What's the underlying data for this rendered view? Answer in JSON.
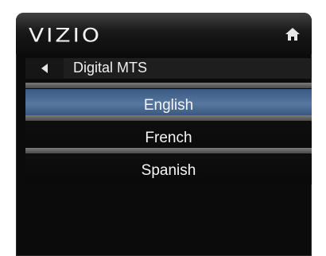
{
  "header": {
    "brand": "VIZIO"
  },
  "nav": {
    "title": "Digital MTS"
  },
  "menu": {
    "items": [
      {
        "label": "English",
        "selected": true
      },
      {
        "label": "French",
        "selected": false
      },
      {
        "label": "Spanish",
        "selected": false
      }
    ]
  },
  "colors": {
    "selected_bg": "#4a6b95",
    "frame_bg": "#0b0b0b",
    "separator": "#6a6a6a"
  },
  "icons": {
    "home": "home-icon",
    "back": "back-arrow-icon"
  }
}
